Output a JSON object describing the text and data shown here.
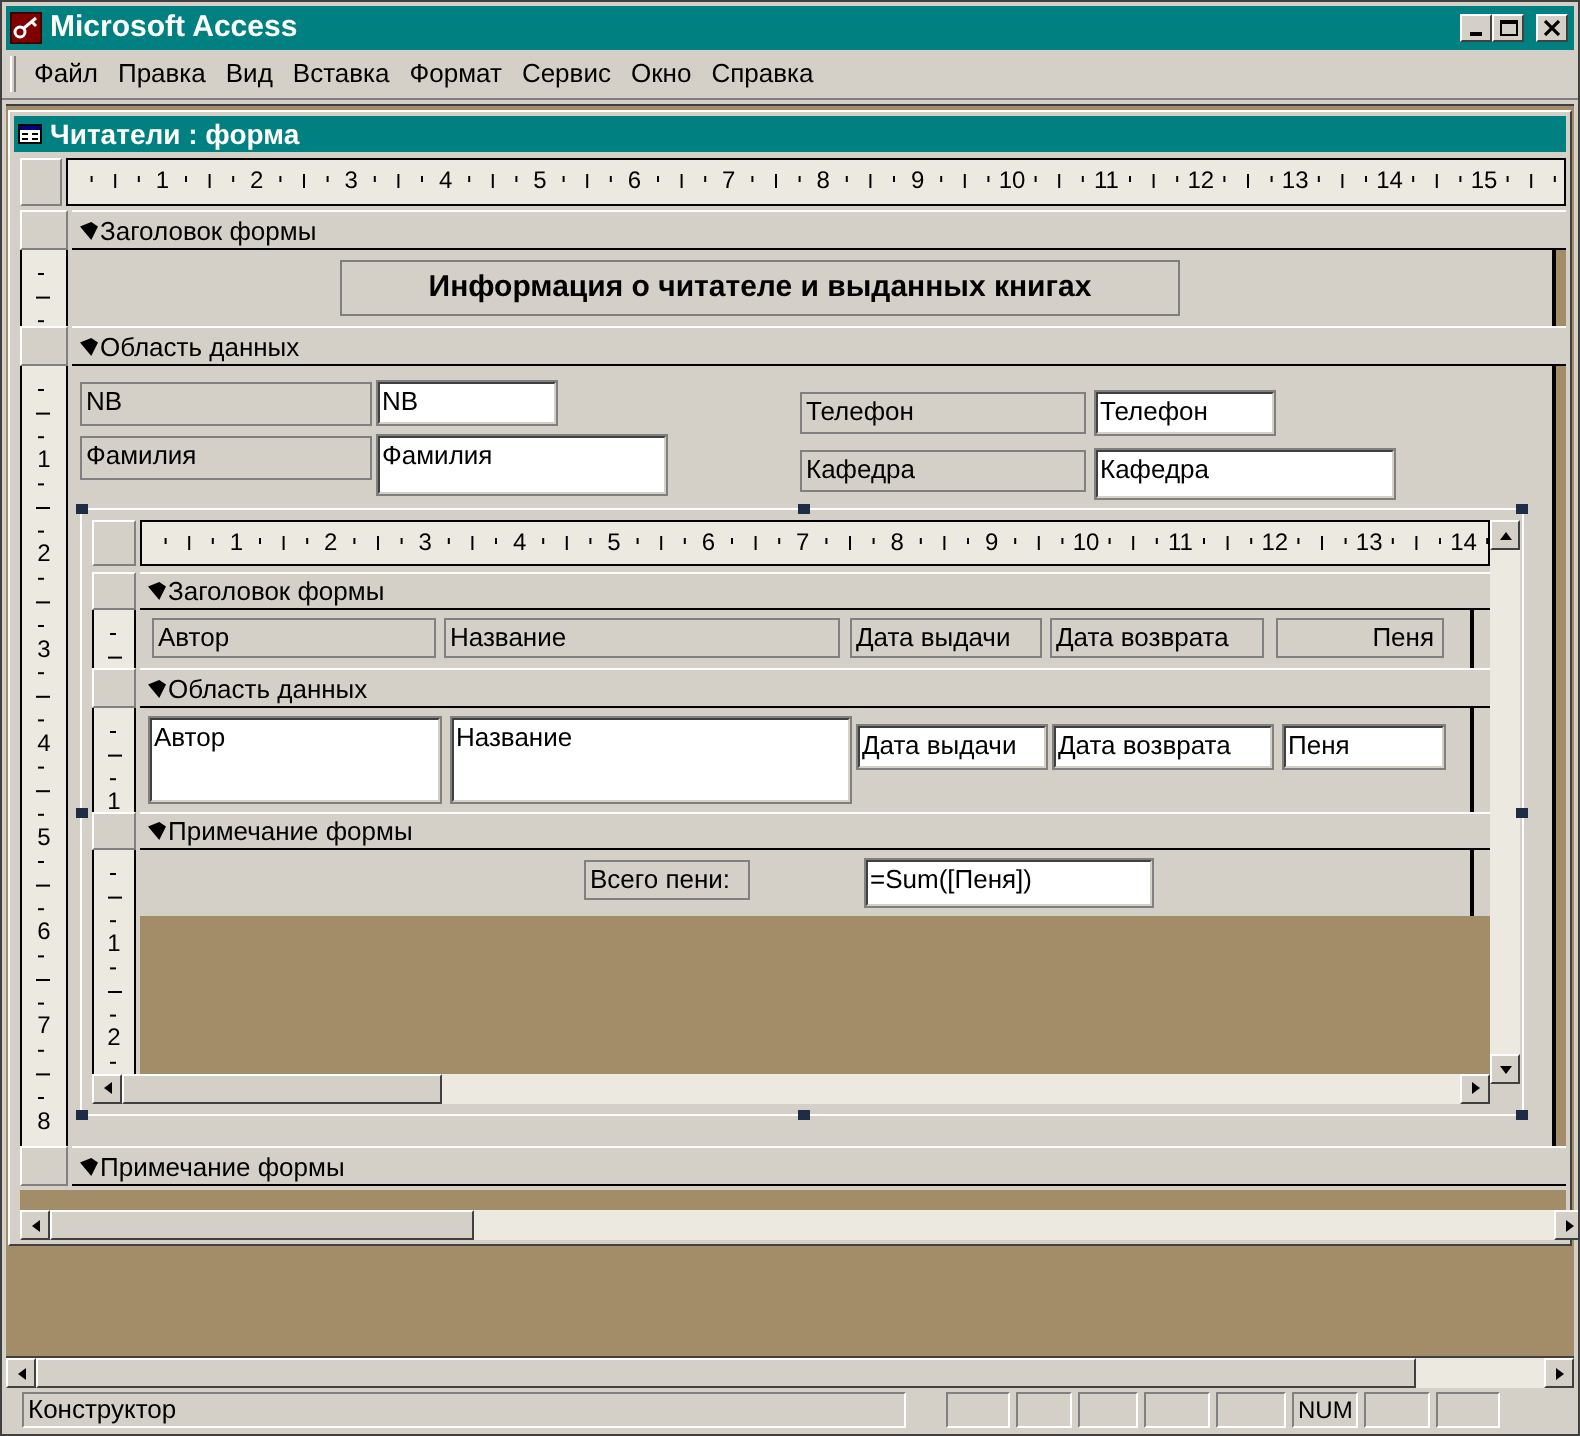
{
  "app_title": "Microsoft Access",
  "menu": [
    "Файл",
    "Правка",
    "Вид",
    "Вставка",
    "Формат",
    "Сервис",
    "Окно",
    "Справка"
  ],
  "form_window": {
    "title": "Читатели : форма",
    "ruler": [
      "1",
      "2",
      "3",
      "4",
      "5",
      "6",
      "7",
      "8",
      "9",
      "10",
      "11",
      "12",
      "13",
      "14",
      "15"
    ],
    "sections": [
      {
        "kind": "header",
        "title": "Заголовок формы",
        "controls": [
          {
            "kind": "label",
            "text": "Информация о читателе и выданных книгах"
          }
        ]
      },
      {
        "kind": "detail",
        "title": "Область данных",
        "ruler_marks": [
          "1",
          "2",
          "3",
          "4",
          "5",
          "6",
          "7",
          "8"
        ],
        "controls": [
          {
            "kind": "label",
            "text": "NB"
          },
          {
            "kind": "textbox",
            "text": "NB"
          },
          {
            "kind": "label",
            "text": "Фамилия"
          },
          {
            "kind": "textbox",
            "text": "Фамилия"
          },
          {
            "kind": "label",
            "text": "Телефон"
          },
          {
            "kind": "textbox",
            "text": "Телефон"
          },
          {
            "kind": "label",
            "text": "Кафедра"
          },
          {
            "kind": "textbox",
            "text": "Кафедра"
          },
          {
            "kind": "subform",
            "selected": true,
            "ruler": [
              "1",
              "2",
              "3",
              "4",
              "5",
              "6",
              "7",
              "8",
              "9",
              "10",
              "11",
              "12",
              "13",
              "14"
            ],
            "sections": [
              {
                "kind": "header",
                "title": "Заголовок формы",
                "controls": [
                  {
                    "kind": "label",
                    "text": "Автор"
                  },
                  {
                    "kind": "label",
                    "text": "Название"
                  },
                  {
                    "kind": "label",
                    "text": "Дата выдачи"
                  },
                  {
                    "kind": "label",
                    "text": "Дата возврата"
                  },
                  {
                    "kind": "label",
                    "text": "Пеня"
                  }
                ]
              },
              {
                "kind": "detail",
                "title": "Область данных",
                "ruler_marks": [
                  "1"
                ],
                "controls": [
                  {
                    "kind": "textbox",
                    "text": "Автор"
                  },
                  {
                    "kind": "textbox",
                    "text": "Название"
                  },
                  {
                    "kind": "textbox",
                    "text": "Дата выдачи"
                  },
                  {
                    "kind": "textbox",
                    "text": "Дата возврата"
                  },
                  {
                    "kind": "textbox",
                    "text": "Пеня"
                  }
                ]
              },
              {
                "kind": "footer",
                "title": "Примечание формы",
                "ruler_marks": [
                  "1",
                  "2"
                ],
                "controls": [
                  {
                    "kind": "label",
                    "text": "Всего пени:"
                  },
                  {
                    "kind": "textbox",
                    "text": "=Sum([Пеня])"
                  }
                ]
              }
            ]
          }
        ]
      },
      {
        "kind": "footer",
        "title": "Примечание формы"
      }
    ]
  },
  "status_bar": {
    "text": "Конструктор",
    "indicator": "NUM"
  }
}
